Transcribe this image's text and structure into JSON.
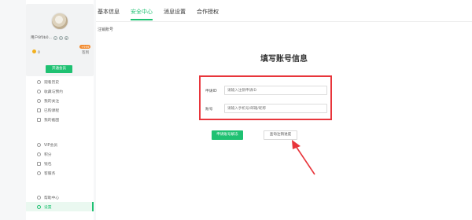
{
  "sidebar": {
    "username": "用户6f0b0...",
    "coins": "0",
    "checkin": "签到",
    "badge": "+999",
    "open_vip": "开通会员",
    "group1": [
      {
        "label": "观看历史",
        "icon": "history-icon"
      },
      {
        "label": "收藏与预约",
        "icon": "star-icon"
      },
      {
        "label": "我的关注",
        "icon": "follow-icon"
      },
      {
        "label": "已购课程",
        "icon": "course-icon"
      },
      {
        "label": "我的截图",
        "icon": "screenshot-icon"
      }
    ],
    "group2": [
      {
        "label": "VIP会员",
        "icon": "vip-icon"
      },
      {
        "label": "积分",
        "icon": "points-icon"
      },
      {
        "label": "钱包",
        "icon": "wallet-icon"
      },
      {
        "label": "客服务",
        "icon": "service-icon"
      }
    ],
    "group3": [
      {
        "label": "帮助中心",
        "icon": "help-icon"
      },
      {
        "label": "设置",
        "icon": "settings-icon"
      }
    ]
  },
  "tabs": [
    "基本信息",
    "安全中心",
    "消息设置",
    "合作授权"
  ],
  "active_tab": "安全中心",
  "main": {
    "section_label": "注销账号",
    "form_title": "填写账号信息",
    "fields": {
      "reason_label": "申请ID",
      "reason_placeholder": "请输入注销申请ID",
      "account_label": "账号",
      "account_placeholder": "请输入手机号/邮箱/昵称"
    },
    "apply_button": "申请账号解冻",
    "progress_button": "查询注销进度"
  },
  "colors": {
    "accent": "#1fc172",
    "highlight": "#e8353b"
  }
}
